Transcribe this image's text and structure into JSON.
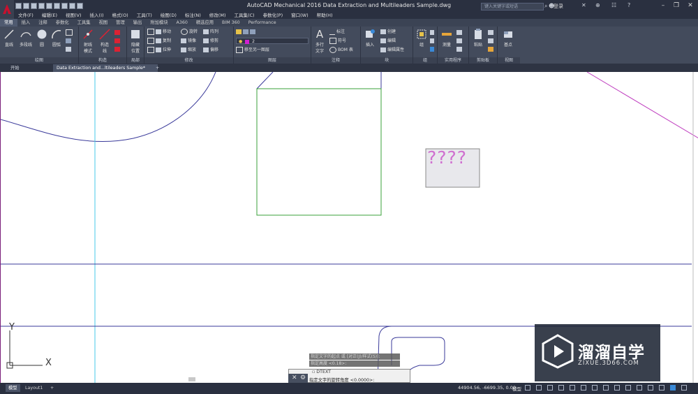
{
  "app": {
    "title": "AutoCAD Mechanical 2016     Data Extraction and Multileaders Sample.dwg",
    "search_placeholder": "键入关键字或短语",
    "login": "登录",
    "help": "?"
  },
  "menubar": [
    "文件(F)",
    "编辑(E)",
    "视图(V)",
    "插入(I)",
    "格式(O)",
    "工具(T)",
    "绘图(D)",
    "标注(N)",
    "修改(M)",
    "工具集(C)",
    "参数化(P)",
    "窗口(W)",
    "帮助(H)"
  ],
  "ribbon_tabs": [
    "常用",
    "插入",
    "注释",
    "参数化",
    "工具集",
    "视图",
    "管理",
    "输出",
    "附加模块",
    "A360",
    "精选应用",
    "BIM 360",
    "Performance"
  ],
  "ribbon": {
    "draw": {
      "title": "绘图",
      "line": "直线",
      "polyline": "多段线",
      "circle": "圆",
      "arc": "圆弧"
    },
    "layers_group": {
      "title": "构造",
      "snap": "射线\n模式",
      "construct": "构造\n线"
    },
    "hide": {
      "title": "局部",
      "label": "隐藏\n位置"
    },
    "modify": {
      "title": "修改",
      "move": "移动",
      "rotate": "旋转",
      "array": "阵列",
      "copy": "复制",
      "mirror": "镜像",
      "fillet": "修剪",
      "stretch": "拉伸",
      "scale": "缩放",
      "offset": "偏移"
    },
    "layer": {
      "title": "图层",
      "current": "2",
      "move_to": "移至另一图层"
    },
    "annotation": {
      "title": "注释",
      "mtext": "多行\n文字",
      "dim": "标注",
      "symbol": "符号",
      "bom": "BOM 表"
    },
    "block": {
      "title": "块",
      "insert": "插入",
      "create": "创建",
      "edit": "编辑",
      "attr": "编辑属性"
    },
    "group": {
      "title": "组",
      "label": "组"
    },
    "utilities": {
      "title": "实用程序",
      "measure": "测量"
    },
    "clipboard": {
      "title": "剪贴板",
      "paste": "粘贴"
    },
    "view": {
      "title": "视图",
      "base": "基点"
    }
  },
  "doc_tabs": {
    "start": "开始",
    "file": "Data Extraction and...ltileaders Sample*",
    "add": "+"
  },
  "canvas": {
    "placeholder_text": "????",
    "ucs_y": "Y",
    "ucs_x": "X"
  },
  "command": {
    "history": [
      "指定文字的起点 或 [对正(J)/样式(S)]:",
      "指定高度 <0.18>:"
    ],
    "current": "DTEXT",
    "prompt": "指定文字的旋转角度 <0.0000>:"
  },
  "status": {
    "layout_tabs": [
      "模型",
      "Layout1",
      "+"
    ],
    "coords": "44904.56, -6699.35, 0.00",
    "model": "模型"
  },
  "watermark": {
    "text": "溜溜自学",
    "url": "ZIXUE.3D66.COM"
  },
  "colors": {
    "titlebar": "#2a3040",
    "ribbon": "#434b5c",
    "accent": "#c8102e",
    "drawing_blue": "#3a3a9a",
    "drawing_green": "#3aa03a",
    "drawing_magenta": "#c040c0"
  }
}
